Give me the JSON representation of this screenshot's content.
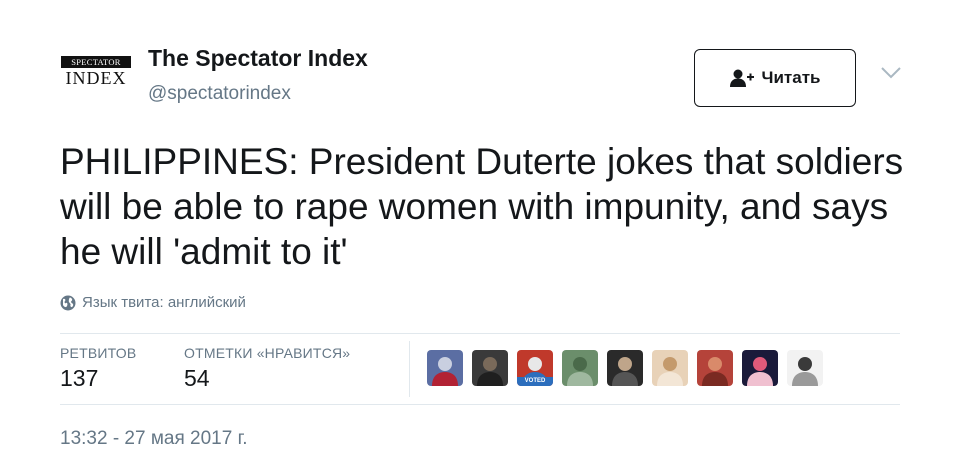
{
  "author": {
    "display_name": "The Spectator Index",
    "screen_name": "@spectatorindex",
    "avatar_text_top": "SPECTATOR",
    "avatar_text_bottom": "INDEX"
  },
  "follow_button": {
    "label": "Читать",
    "icon": "follow-person-plus-icon"
  },
  "menu": {
    "icon": "chevron-down-icon"
  },
  "tweet": {
    "text": "PHILIPPINES: President Duterte jokes that soldiers will be able to rape women with impunity, and says he will 'admit to it'"
  },
  "language": {
    "icon": "globe-icon",
    "label": "Язык твита: английский"
  },
  "stats": {
    "retweets_label": "РЕТВИТОВ",
    "retweets_value": "137",
    "likes_label": "ОТМЕТКИ «НРАВИТСЯ»",
    "likes_value": "54"
  },
  "likers": [
    {
      "name": "liker-1",
      "colors": [
        "#5b6ea3",
        "#c9cfe0",
        "#b22234"
      ]
    },
    {
      "name": "liker-2",
      "colors": [
        "#3a3a3a",
        "#7a6a5a",
        "#1f1f1f"
      ]
    },
    {
      "name": "liker-3",
      "colors": [
        "#c0392b",
        "#e8e8e8",
        "#2c6ebd"
      ],
      "badge": "VOTED"
    },
    {
      "name": "liker-4",
      "colors": [
        "#6b8e6b",
        "#4a6a4a",
        "#9fb89f"
      ]
    },
    {
      "name": "liker-5",
      "colors": [
        "#2a2a2a",
        "#bfa58a",
        "#555555"
      ]
    },
    {
      "name": "liker-6",
      "colors": [
        "#e8d2b8",
        "#c49a6c",
        "#f3e6d6"
      ]
    },
    {
      "name": "liker-7",
      "colors": [
        "#b5433a",
        "#d98a6a",
        "#7a2a22"
      ]
    },
    {
      "name": "liker-8",
      "colors": [
        "#1a1a3a",
        "#e05a7a",
        "#f0c0d0"
      ]
    },
    {
      "name": "liker-9",
      "colors": [
        "#f2f2f2",
        "#3a3a3a",
        "#9a9a9a"
      ]
    }
  ],
  "timestamp": "13:32 - 27 мая 2017 г."
}
